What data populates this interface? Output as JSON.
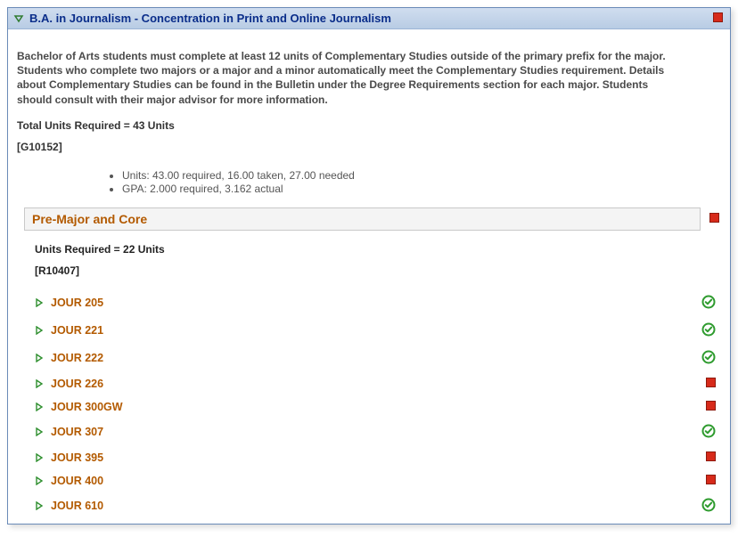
{
  "header": {
    "title": "B.A. in Journalism - Concentration in Print and Online Journalism",
    "status": "incomplete"
  },
  "description": "Bachelor of Arts students must complete at least 12 units of Complementary Studies outside of the primary prefix for the major. Students who complete two majors or a major and a minor automatically meet the Complementary Studies requirement. Details about Complementary Studies can be found in the Bulletin under the Degree Requirements section for each major. Students should consult with their major advisor for more information.",
  "total_units_label": "Total Units Required = 43 Units",
  "group_code": "[G10152]",
  "stats": {
    "units_line": "Units: 43.00 required, 16.00 taken, 27.00 needed",
    "gpa_line": "GPA: 2.000 required, 3.162 actual"
  },
  "section": {
    "title": "Pre-Major and Core",
    "status": "incomplete",
    "units_label": "Units Required = 22 Units",
    "code": "[R10407]",
    "courses": [
      {
        "name": "JOUR 205",
        "status": "complete"
      },
      {
        "name": "JOUR 221",
        "status": "complete"
      },
      {
        "name": "JOUR 222",
        "status": "complete"
      },
      {
        "name": "JOUR 226",
        "status": "incomplete"
      },
      {
        "name": "JOUR 300GW",
        "status": "incomplete"
      },
      {
        "name": "JOUR 307",
        "status": "complete"
      },
      {
        "name": "JOUR 395",
        "status": "incomplete"
      },
      {
        "name": "JOUR 400",
        "status": "incomplete"
      },
      {
        "name": "JOUR 610",
        "status": "complete"
      }
    ]
  }
}
